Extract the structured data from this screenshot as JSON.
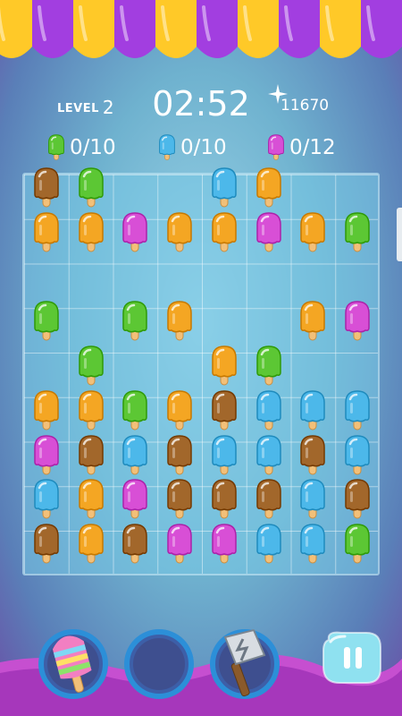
{
  "hud": {
    "level_label": "LEVEL",
    "level_number": "2",
    "timer": "02:52",
    "score": "11670"
  },
  "goals": [
    {
      "color": "green",
      "count": "0/10"
    },
    {
      "color": "blue",
      "count": "0/10"
    },
    {
      "color": "pink",
      "count": "0/12"
    }
  ],
  "colors": {
    "orange": "#f4a623",
    "green": "#5cc734",
    "blue": "#4cb8ea",
    "pink": "#d84fd6",
    "brown": "#a2672b",
    "awning_yellow": "#ffc928",
    "awning_purple": "#a23ee0"
  },
  "board": {
    "cols": 8,
    "rows": 9,
    "popsicles": [
      {
        "col": 0,
        "row": 0,
        "color": "brown"
      },
      {
        "col": 1,
        "row": 0,
        "color": "green"
      },
      {
        "col": 4,
        "row": 0,
        "color": "blue"
      },
      {
        "col": 5,
        "row": 0,
        "color": "orange"
      },
      {
        "col": 0,
        "row": 1,
        "color": "orange"
      },
      {
        "col": 1,
        "row": 1,
        "color": "orange"
      },
      {
        "col": 2,
        "row": 1,
        "color": "pink"
      },
      {
        "col": 3,
        "row": 1,
        "color": "orange"
      },
      {
        "col": 4,
        "row": 1,
        "color": "orange"
      },
      {
        "col": 5,
        "row": 1,
        "color": "pink"
      },
      {
        "col": 6,
        "row": 1,
        "color": "orange"
      },
      {
        "col": 7,
        "row": 1,
        "color": "green"
      },
      {
        "col": 0,
        "row": 3,
        "color": "green"
      },
      {
        "col": 2,
        "row": 3,
        "color": "green"
      },
      {
        "col": 3,
        "row": 3,
        "color": "orange"
      },
      {
        "col": 6,
        "row": 3,
        "color": "orange"
      },
      {
        "col": 7,
        "row": 3,
        "color": "pink"
      },
      {
        "col": 1,
        "row": 4,
        "color": "green"
      },
      {
        "col": 4,
        "row": 4,
        "color": "orange"
      },
      {
        "col": 5,
        "row": 4,
        "color": "green"
      },
      {
        "col": 0,
        "row": 5,
        "color": "orange"
      },
      {
        "col": 1,
        "row": 5,
        "color": "orange"
      },
      {
        "col": 2,
        "row": 5,
        "color": "green"
      },
      {
        "col": 3,
        "row": 5,
        "color": "orange"
      },
      {
        "col": 4,
        "row": 5,
        "color": "brown"
      },
      {
        "col": 5,
        "row": 5,
        "color": "blue"
      },
      {
        "col": 6,
        "row": 5,
        "color": "blue"
      },
      {
        "col": 7,
        "row": 5,
        "color": "blue"
      },
      {
        "col": 0,
        "row": 6,
        "color": "pink"
      },
      {
        "col": 1,
        "row": 6,
        "color": "brown"
      },
      {
        "col": 2,
        "row": 6,
        "color": "blue"
      },
      {
        "col": 3,
        "row": 6,
        "color": "brown"
      },
      {
        "col": 4,
        "row": 6,
        "color": "blue"
      },
      {
        "col": 5,
        "row": 6,
        "color": "blue"
      },
      {
        "col": 6,
        "row": 6,
        "color": "brown"
      },
      {
        "col": 7,
        "row": 6,
        "color": "blue"
      },
      {
        "col": 0,
        "row": 7,
        "color": "blue"
      },
      {
        "col": 1,
        "row": 7,
        "color": "orange"
      },
      {
        "col": 2,
        "row": 7,
        "color": "pink"
      },
      {
        "col": 3,
        "row": 7,
        "color": "brown"
      },
      {
        "col": 4,
        "row": 7,
        "color": "brown"
      },
      {
        "col": 5,
        "row": 7,
        "color": "brown"
      },
      {
        "col": 6,
        "row": 7,
        "color": "blue"
      },
      {
        "col": 7,
        "row": 7,
        "color": "brown"
      },
      {
        "col": 0,
        "row": 8,
        "color": "brown"
      },
      {
        "col": 1,
        "row": 8,
        "color": "orange"
      },
      {
        "col": 2,
        "row": 8,
        "color": "brown"
      },
      {
        "col": 3,
        "row": 8,
        "color": "pink"
      },
      {
        "col": 4,
        "row": 8,
        "color": "pink"
      },
      {
        "col": 5,
        "row": 8,
        "color": "blue"
      },
      {
        "col": 6,
        "row": 8,
        "color": "blue"
      },
      {
        "col": 7,
        "row": 8,
        "color": "green"
      }
    ]
  },
  "boosters": [
    {
      "name": "striped-popsicle-booster-icon"
    },
    {
      "name": "empty-booster-slot"
    },
    {
      "name": "hammer-booster-icon"
    }
  ],
  "pause": {
    "icon": "pause-icon"
  }
}
